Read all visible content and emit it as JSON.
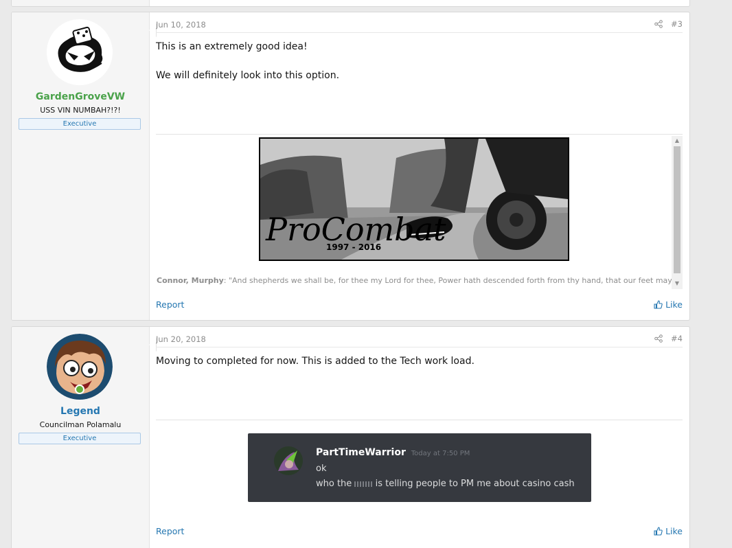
{
  "posts": [
    {
      "date": "Jun 10, 2018",
      "number": "#3",
      "username": "GardenGroveVW",
      "username_color": "#4aa24a",
      "user_title": "USS VIN NUMBAH?!?!",
      "banner": "Executive",
      "message_lines": [
        "This is an extremely good idea!",
        "We will definitely look into this option."
      ],
      "signature": {
        "image_text": "ProCombat",
        "image_years": "1997 - 2016",
        "quote_author": "Connor, Murphy",
        "quote_text": ": \"And shepherds we shall be, for thee my Lord for thee, Power hath descended forth from thy hand, that our feet may swiftly"
      },
      "report_label": "Report",
      "like_label": "Like"
    },
    {
      "date": "Jun 20, 2018",
      "number": "#4",
      "username": "Legend",
      "username_color": "#2577b1",
      "user_title": "Councilman Polamalu",
      "banner": "Executive",
      "message_lines": [
        "Moving to completed for now. This is added to the Tech work load."
      ],
      "discord": {
        "author": "PartTimeWarrior",
        "timestamp": "Today at 7:50 PM",
        "line1": "ok",
        "line2_before": "who the",
        "line2_after": "is telling people to PM me about casino cash"
      },
      "report_label": "Report",
      "like_label": "Like"
    }
  ],
  "icons": {
    "share": "share-icon",
    "like": "thumbs-up-icon"
  }
}
